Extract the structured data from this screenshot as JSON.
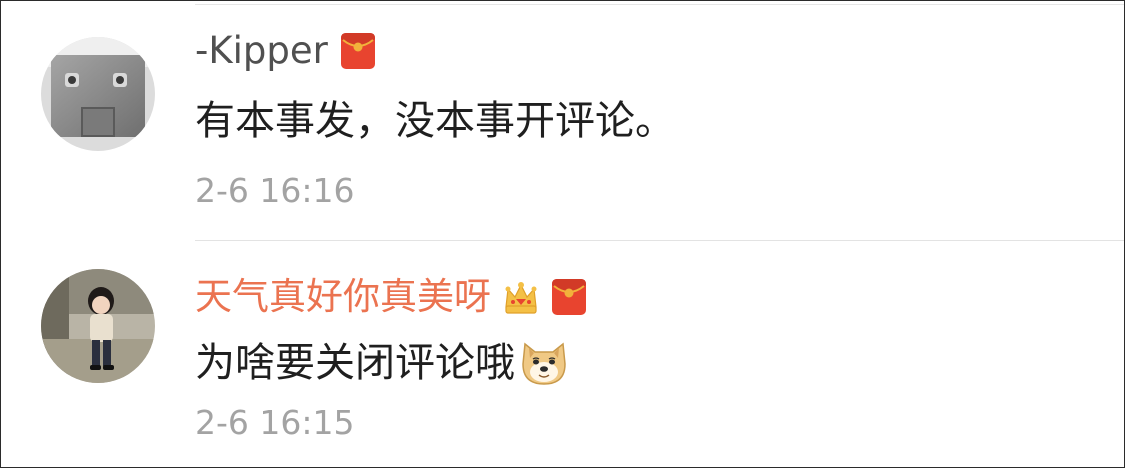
{
  "comments": [
    {
      "username": "-Kipper",
      "text": "有本事发，没本事开评论。",
      "time": "2-6 16:16",
      "badges": [
        "red-envelope-icon"
      ],
      "avatar": "robot-face-avatar"
    },
    {
      "username": "天气真好你真美呀",
      "text": "为啥要关闭评论哦",
      "time": "2-6 16:15",
      "badges": [
        "crown-icon",
        "red-envelope-icon"
      ],
      "emoji": "doge-emoji",
      "avatar": "child-photo-avatar"
    }
  ],
  "colors": {
    "username_default": "#505050",
    "username_vip": "#eb7350",
    "text": "#1f1f1f",
    "timestamp": "#a3a3a3",
    "envelope": "#e8442f",
    "envelope_flap": "#f2b13b"
  }
}
